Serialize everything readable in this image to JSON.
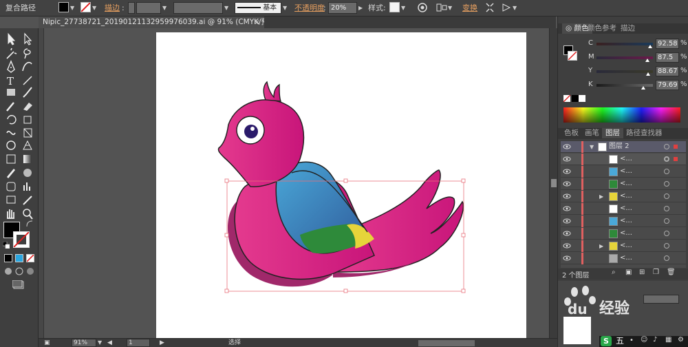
{
  "control_bar": {
    "path_label": "复合路径",
    "stroke_label": "描边",
    "stroke_value": "基本",
    "opacity_label": "不透明度",
    "opacity_value": "20%",
    "style_label": "样式",
    "transform_label": "变换"
  },
  "document": {
    "tab_title": "Nipic_27738721_20190121132959976039.ai @ 91% (CMYK/预览)",
    "close_glyph": "×"
  },
  "status_bar": {
    "zoom": "91%",
    "page": "1",
    "tool_label": "选择"
  },
  "color_panel": {
    "tabs": [
      "颜色",
      "颜色参考",
      "描边"
    ],
    "channels": [
      {
        "name": "C",
        "value": "92.58",
        "level": 0.926
      },
      {
        "name": "M",
        "value": "87.5",
        "level": 0.875
      },
      {
        "name": "Y",
        "value": "88.67",
        "level": 0.887
      },
      {
        "name": "K",
        "value": "79.69",
        "level": 0.797
      }
    ],
    "unit": "%"
  },
  "layers_panel": {
    "tabs": [
      "色板",
      "画笔",
      "图层",
      "路径查找器"
    ],
    "layer_name": "图层 2",
    "row_label": "<...",
    "footer_label": "2 个图层"
  },
  "watermark": {
    "text": "经验",
    "brand_lower": "du"
  },
  "taskbar": {
    "ime_label": "五"
  }
}
